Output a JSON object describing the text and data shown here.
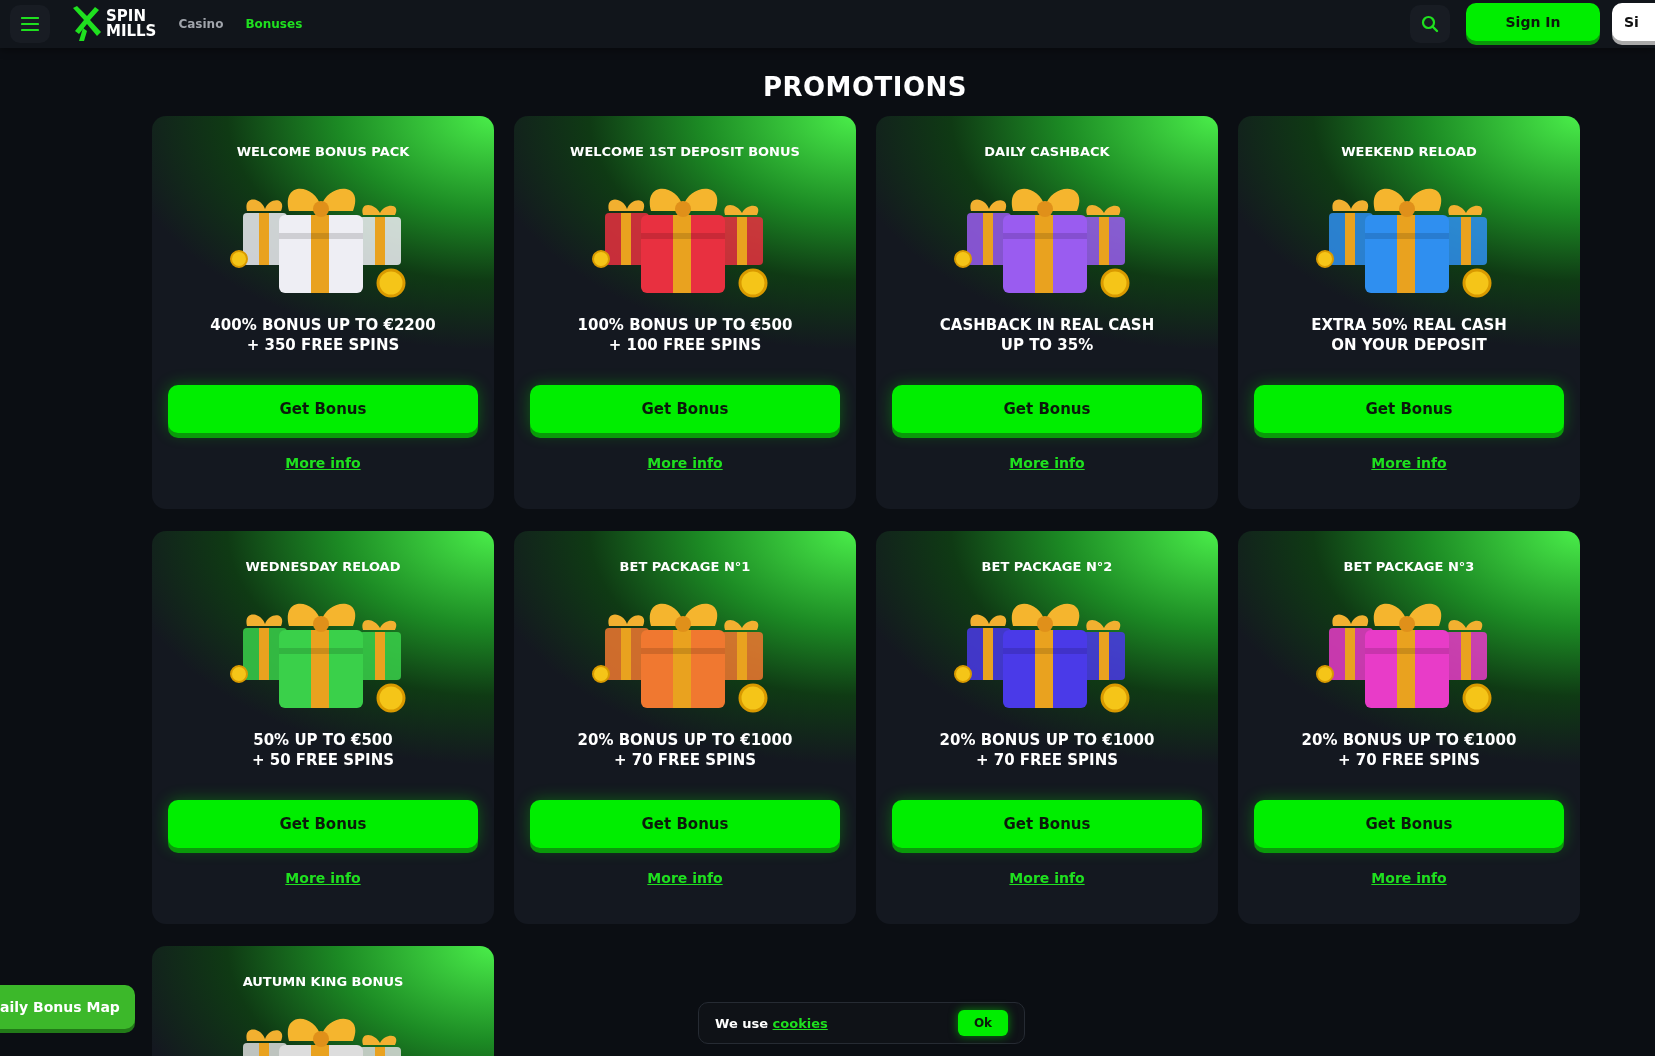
{
  "header": {
    "nav": [
      {
        "label": "Casino",
        "selected": false
      },
      {
        "label": "Bonuses",
        "selected": true
      }
    ],
    "logo": {
      "line_1": "SPIN",
      "line_2": "MILLS"
    },
    "sign_in": "Sign In",
    "sign_up": "Si"
  },
  "title": "PROMOTIONS",
  "cards": [
    {
      "title": "WELCOME BONUS PACK",
      "color": "#eeeef4",
      "offer_1": "400% BONUS UP TO €2200",
      "offer_2": "+ 350 FREE SPINS",
      "button": "Get Bonus",
      "link": "More info"
    },
    {
      "title": "WELCOME 1ST DEPOSIT BONUS",
      "color": "#e83040",
      "offer_1": "100% BONUS UP TO €500",
      "offer_2": "+ 100 FREE SPINS",
      "button": "Get Bonus",
      "link": "More info"
    },
    {
      "title": "DAILY CASHBACK",
      "color": "#9a5cf0",
      "offer_1": "CASHBACK IN REAL CASH",
      "offer_2": "UP TO 35%",
      "button": "Get Bonus",
      "link": "More info"
    },
    {
      "title": "WEEKEND RELOAD",
      "color": "#2f8ff0",
      "offer_1": "EXTRA 50% REAL CASH",
      "offer_2": "ON YOUR DEPOSIT",
      "button": "Get Bonus",
      "link": "More info"
    },
    {
      "title": "WEDNESDAY RELOAD",
      "color": "#3ad04a",
      "offer_1": "50% UP TO €500",
      "offer_2": "+ 50 FREE SPINS",
      "button": "Get Bonus",
      "link": "More info"
    },
    {
      "title": "BET PACKAGE N°1",
      "color": "#f07830",
      "offer_1": "20% BONUS UP TO €1000",
      "offer_2": "+ 70 FREE SPINS",
      "button": "Get Bonus",
      "link": "More info"
    },
    {
      "title": "BET PACKAGE N°2",
      "color": "#4a3ae8",
      "offer_1": "20% BONUS UP TO €1000",
      "offer_2": "+ 70 FREE SPINS",
      "button": "Get Bonus",
      "link": "More info"
    },
    {
      "title": "BET PACKAGE N°3",
      "color": "#e83cc8",
      "offer_1": "20% BONUS UP TO €1000",
      "offer_2": "+ 70 FREE SPINS",
      "button": "Get Bonus",
      "link": "More info"
    },
    {
      "title": "AUTUMN KING BONUS"
    }
  ],
  "bonus_map_tab": "aily Bonus Map",
  "cookie_banner": {
    "text": "We use",
    "link": "cookies",
    "button": "Ok"
  }
}
